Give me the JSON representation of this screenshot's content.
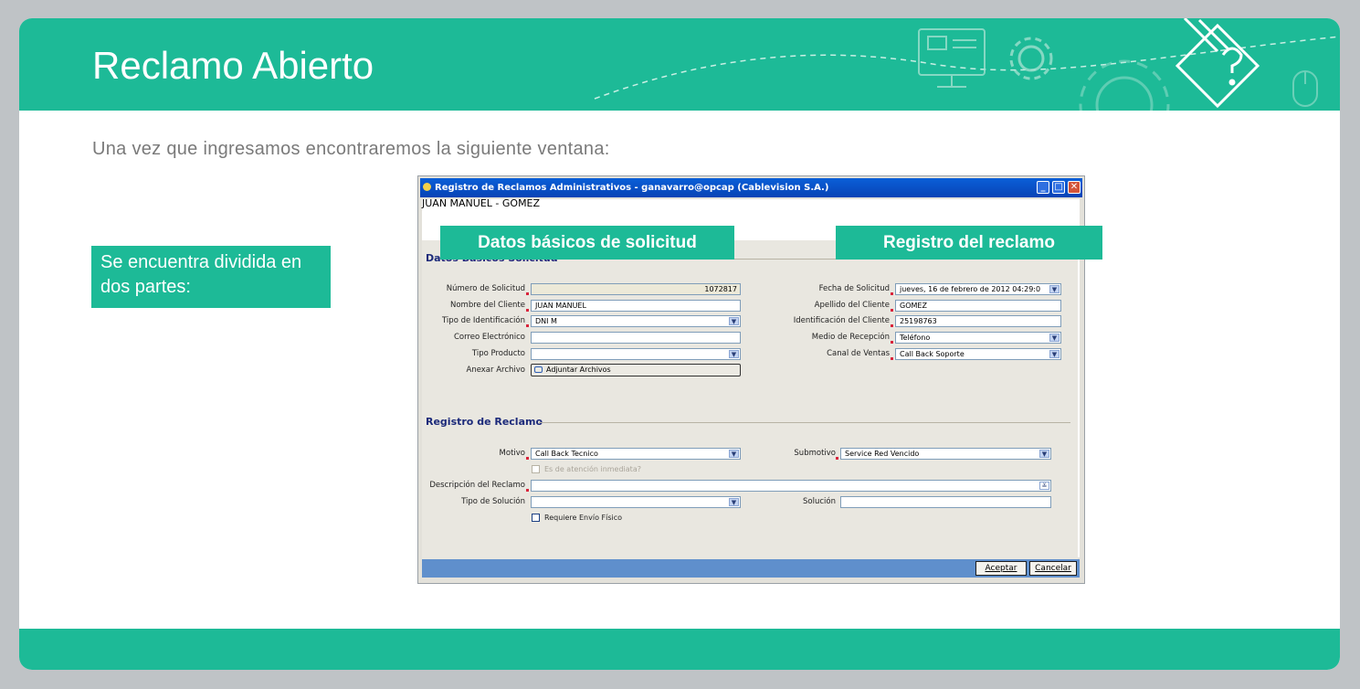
{
  "slide": {
    "title": "Reclamo Abierto",
    "intro": "Una vez que ingresamos encontraremos la siguiente ventana:",
    "callout": "Se encuentra dividida en dos partes:",
    "tags": [
      "Datos básicos de solicitud",
      "Registro del reclamo"
    ],
    "colors": {
      "accent": "#1dba97",
      "background": "#bfc3c6",
      "text_muted": "#7a7a7a"
    }
  },
  "window": {
    "title": "Registro de Reclamos Administrativos - ganavarro@opcap (Cablevision S.A.)",
    "user": "JUAN MANUEL - GOMEZ",
    "controls": [
      "minimize-icon",
      "maximize-icon",
      "close-icon"
    ]
  },
  "datos_basicos": {
    "section_title": "Datos Básicos Solicitud",
    "left": [
      {
        "label": "Número de Solicitud",
        "value": "1072817",
        "type": "readonly",
        "required": true
      },
      {
        "label": "Nombre del Cliente",
        "value": "JUAN MANUEL",
        "type": "text",
        "required": true
      },
      {
        "label": "Tipo de Identificación",
        "value": "DNI M",
        "type": "select",
        "required": true
      },
      {
        "label": "Correo Electrónico",
        "value": "",
        "type": "text",
        "required": false
      },
      {
        "label": "Tipo Producto",
        "value": "",
        "type": "select",
        "required": false
      },
      {
        "label": "Anexar Archivo",
        "value": "Adjuntar Archivos",
        "type": "button",
        "required": false
      }
    ],
    "right": [
      {
        "label": "Fecha de Solicitud",
        "value": "jueves, 16 de febrero de 2012 04:29:0",
        "type": "select",
        "required": true
      },
      {
        "label": "Apellido del Cliente",
        "value": "GOMEZ",
        "type": "text",
        "required": true
      },
      {
        "label": "Identificación del Cliente",
        "value": "25198763",
        "type": "text",
        "required": true
      },
      {
        "label": "Medio de Recepción",
        "value": "Teléfono",
        "type": "select",
        "required": true
      },
      {
        "label": "Canal de Ventas",
        "value": "Call Back Soporte",
        "type": "select",
        "required": true
      }
    ]
  },
  "registro": {
    "section_title": "Registro de Reclamo",
    "motivo_label": "Motivo",
    "motivo_value": "Call Back Tecnico",
    "submotivo_label": "Submotivo",
    "submotivo_value": "Service Red Vencido",
    "inmediata_label": "Es de atención inmediata?",
    "descripcion_label": "Descripción del Reclamo",
    "descripcion_value": "",
    "tipo_solucion_label": "Tipo de Solución",
    "tipo_solucion_value": "",
    "solucion_label": "Solución",
    "solucion_value": "",
    "envio_label": "Requiere Envío Físico"
  },
  "buttons": {
    "accept": "Aceptar",
    "cancel": "Cancelar"
  }
}
